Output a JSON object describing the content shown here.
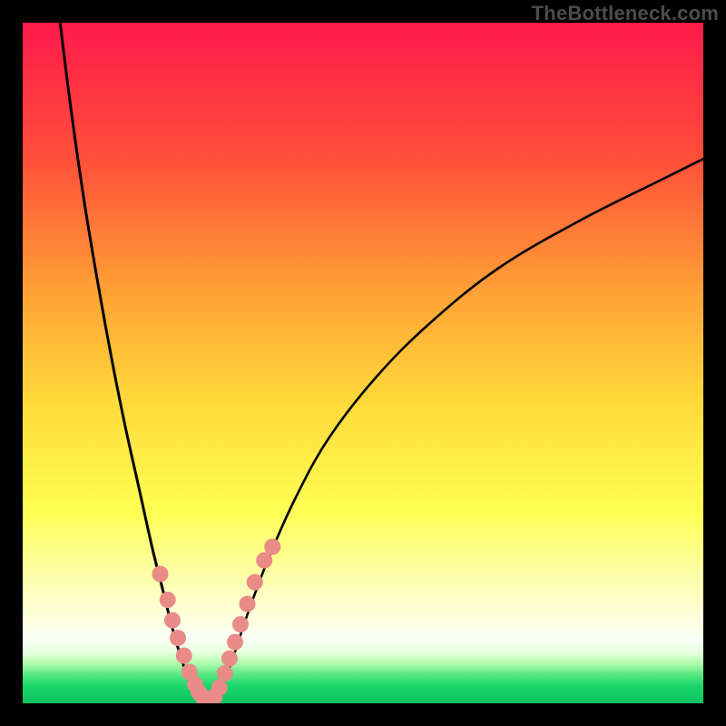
{
  "watermark": "TheBottleneck.com",
  "chart_data": {
    "type": "line",
    "title": "",
    "xlabel": "",
    "ylabel": "",
    "xlim": [
      0,
      100
    ],
    "ylim": [
      0,
      100
    ],
    "grid": false,
    "legend": false,
    "gradient_stops": [
      {
        "offset": 0.0,
        "color": "#ff1a4b"
      },
      {
        "offset": 0.2,
        "color": "#ff4f3a"
      },
      {
        "offset": 0.4,
        "color": "#ffa336"
      },
      {
        "offset": 0.55,
        "color": "#ffd73a"
      },
      {
        "offset": 0.72,
        "color": "#ffff55"
      },
      {
        "offset": 0.82,
        "color": "#fdffb0"
      },
      {
        "offset": 0.885,
        "color": "#fdffe6"
      },
      {
        "offset": 0.905,
        "color": "#fafff6"
      },
      {
        "offset": 0.925,
        "color": "#e8ffe0"
      },
      {
        "offset": 0.94,
        "color": "#b7fcb0"
      },
      {
        "offset": 0.958,
        "color": "#58e882"
      },
      {
        "offset": 0.975,
        "color": "#18d56a"
      },
      {
        "offset": 1.0,
        "color": "#0fc360"
      }
    ],
    "series": [
      {
        "name": "curve-left",
        "stroke": "#000000",
        "stroke_width": 3,
        "x": [
          5.5,
          7,
          9,
          11,
          13,
          15,
          17,
          19,
          20.5,
          22,
          23.5,
          25,
          26
        ],
        "y": [
          100,
          88,
          74,
          62,
          51,
          41,
          32,
          23,
          17,
          11,
          6,
          2,
          0.5
        ]
      },
      {
        "name": "curve-right",
        "stroke": "#000000",
        "stroke_width": 2.6,
        "x": [
          28,
          29.5,
          31,
          33,
          36,
          40,
          45,
          52,
          60,
          70,
          82,
          94,
          100
        ],
        "y": [
          0.5,
          3,
          7,
          13,
          21,
          30,
          39,
          48,
          56,
          64,
          71,
          77,
          80
        ]
      },
      {
        "name": "curve-bottom",
        "stroke": "#000000",
        "stroke_width": 3,
        "x": [
          26,
          27,
          28
        ],
        "y": [
          0.5,
          0.3,
          0.5
        ]
      },
      {
        "name": "dots-left",
        "type": "scatter",
        "color": "#e98b87",
        "radius": 9,
        "x": [
          20.2,
          21.3,
          22.0,
          22.8,
          23.7,
          24.5,
          25.3,
          25.9,
          26.5,
          27.3
        ],
        "y": [
          19.0,
          15.2,
          12.2,
          9.6,
          7.0,
          4.6,
          2.8,
          1.6,
          0.9,
          0.6
        ]
      },
      {
        "name": "dots-right",
        "type": "scatter",
        "color": "#e98b87",
        "radius": 9,
        "x": [
          28.2,
          28.9,
          29.7,
          30.4,
          31.2,
          32.0,
          33.0,
          34.1,
          35.5,
          36.7
        ],
        "y": [
          1.0,
          2.3,
          4.4,
          6.6,
          9.0,
          11.6,
          14.6,
          17.8,
          21.0,
          23.0
        ]
      }
    ]
  }
}
